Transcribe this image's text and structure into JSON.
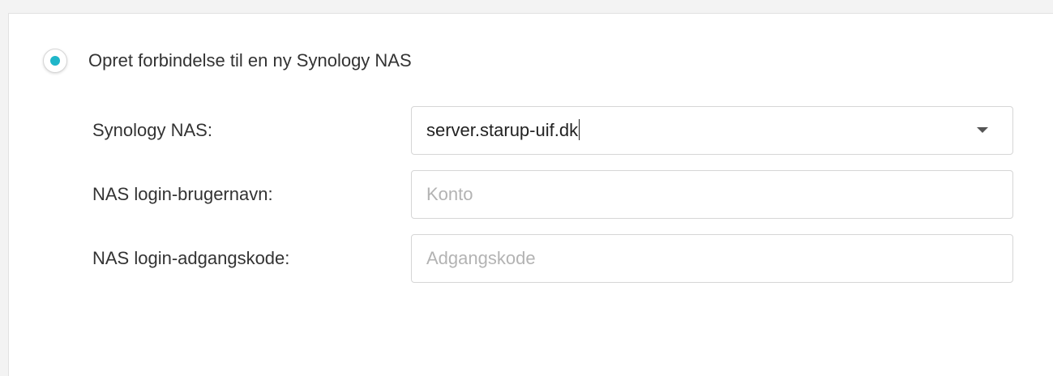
{
  "connection_option": {
    "label": "Opret forbindelse til en ny Synology NAS",
    "selected": true,
    "accent_color": "#1fb6c9"
  },
  "fields": {
    "nas": {
      "label": "Synology NAS:",
      "value": "server.starup-uif.dk"
    },
    "username": {
      "label": "NAS login-brugernavn:",
      "placeholder": "Konto",
      "value": ""
    },
    "password": {
      "label": "NAS login-adgangskode:",
      "placeholder": "Adgangskode",
      "value": ""
    }
  }
}
